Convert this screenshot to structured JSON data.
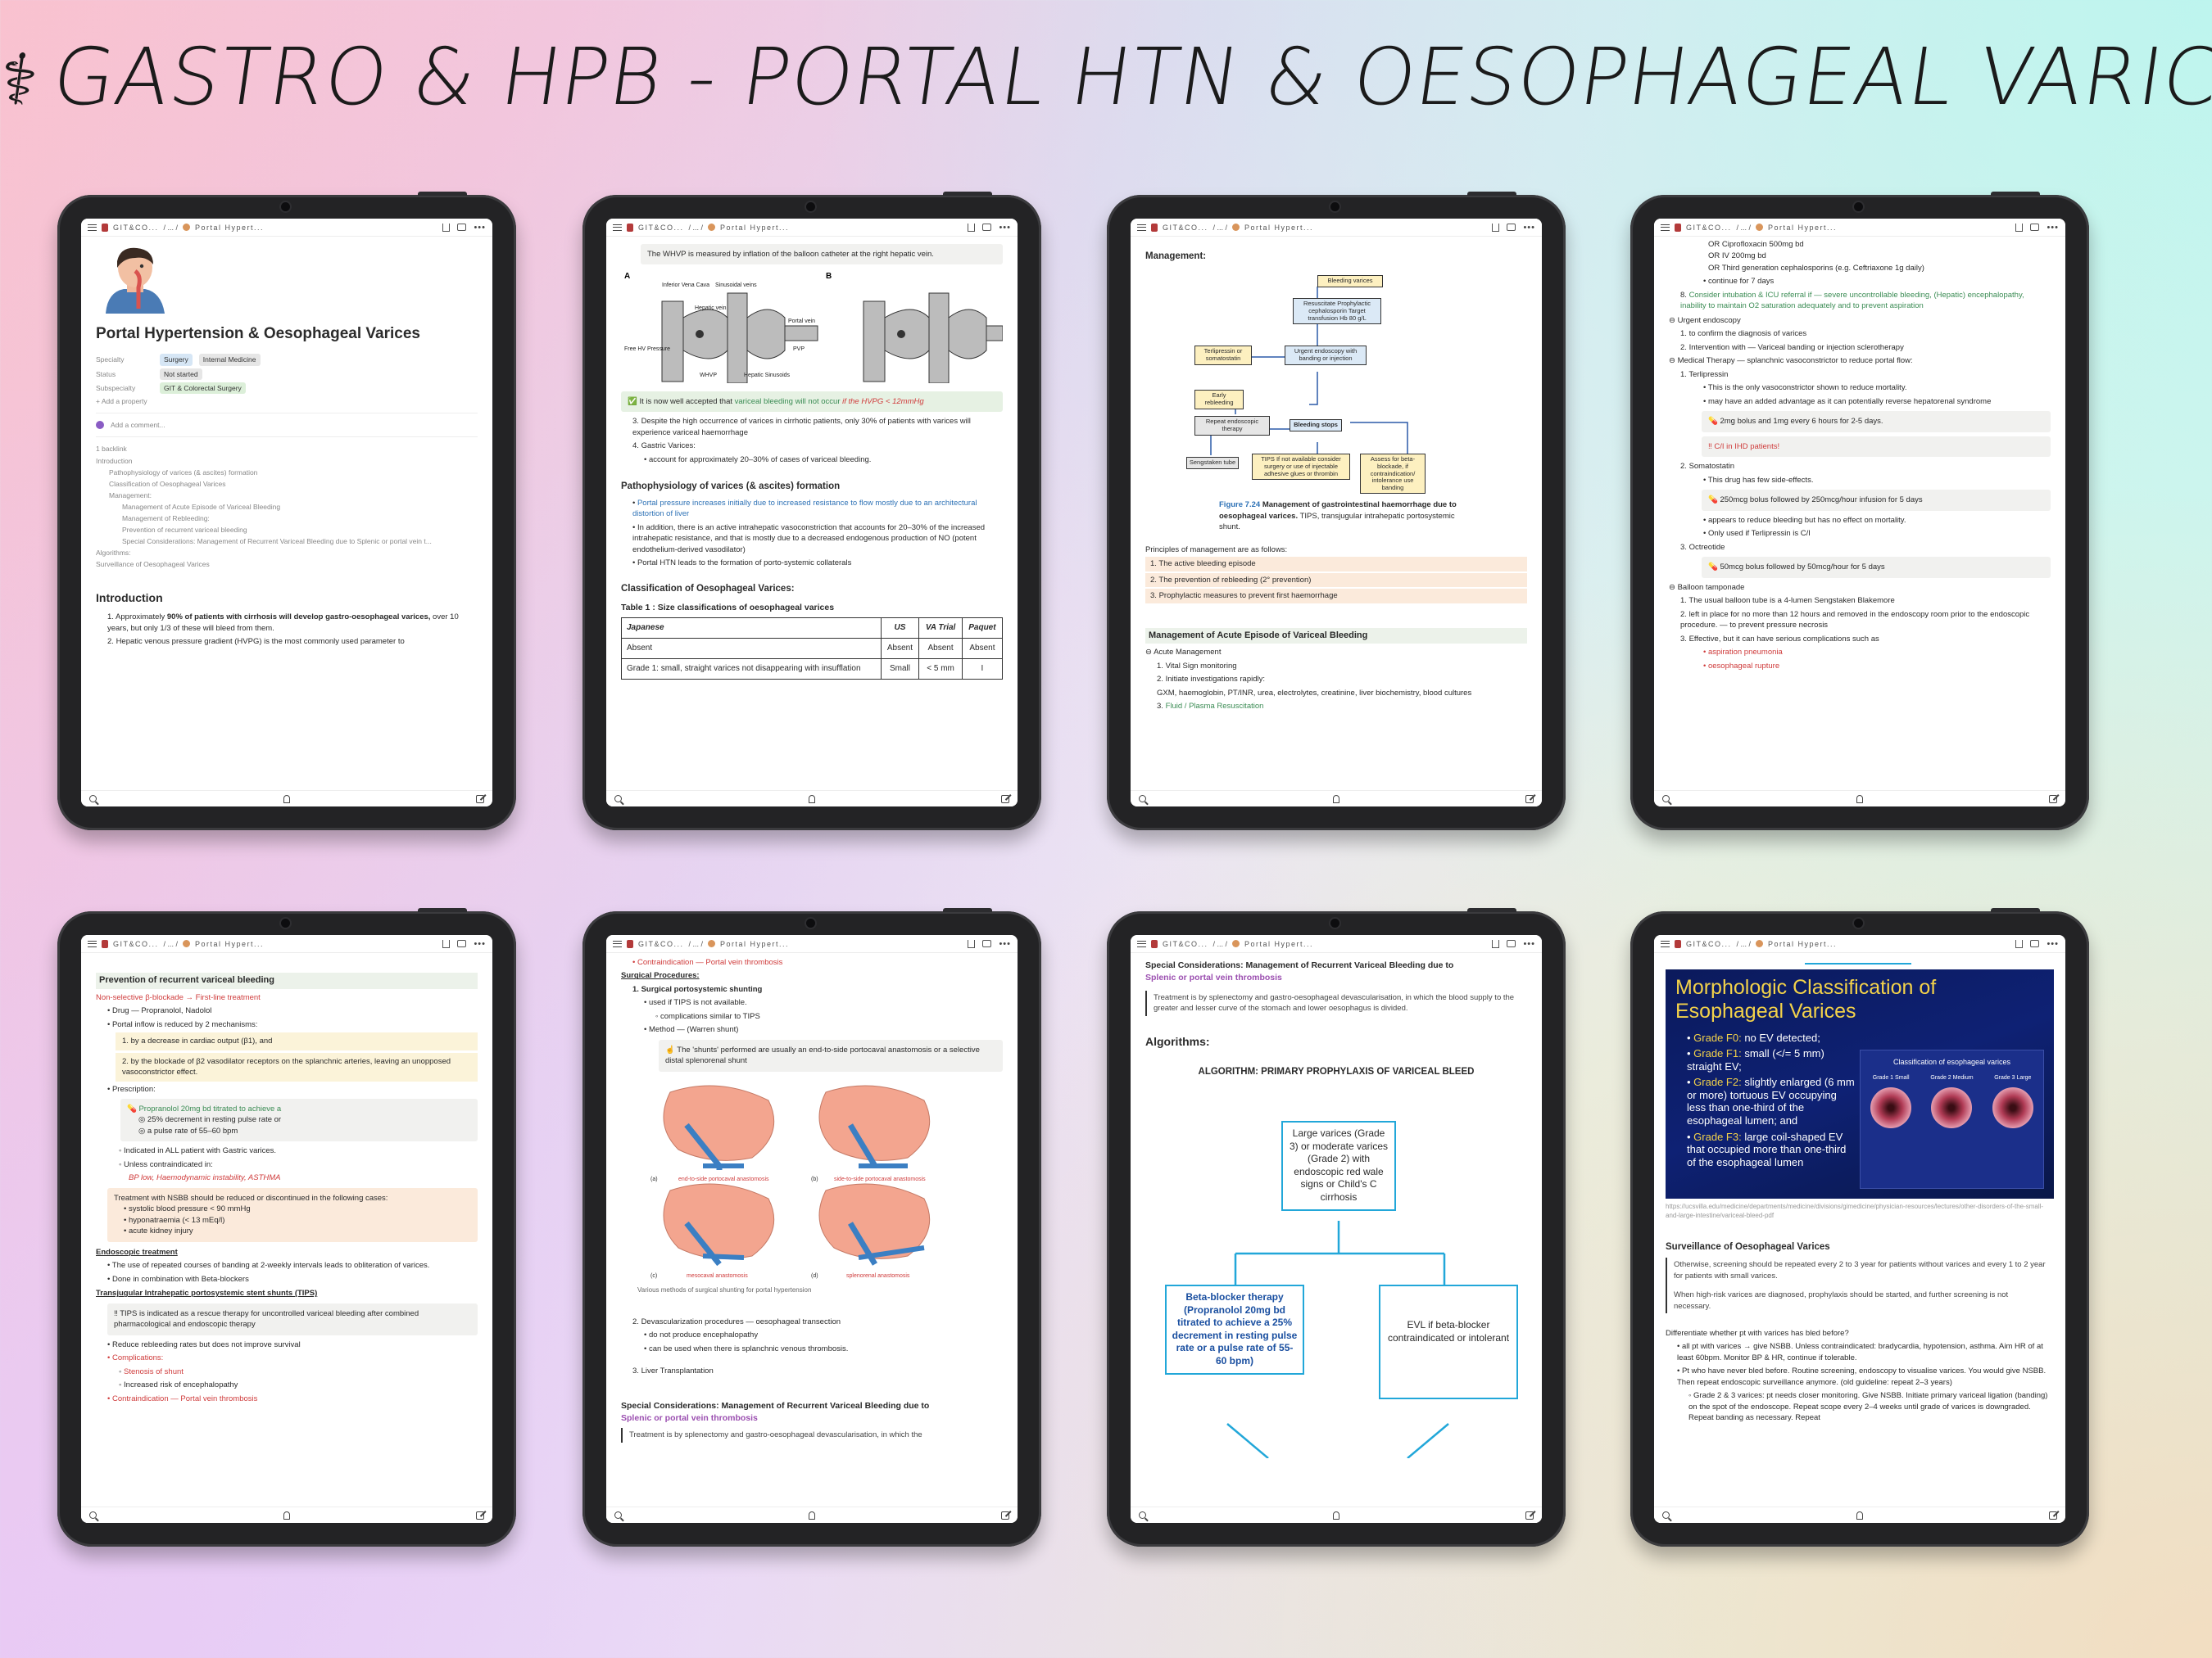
{
  "title": {
    "prefix": "⚕",
    "text": "GASTRO & HPB - PORTAL HTN & OESOPHAGEAL VARICES"
  },
  "topbar": {
    "workspace": "GIT&CO...",
    "sep": "/ ... /",
    "page": "Portal Hypert..."
  },
  "t1": {
    "heading": "Portal Hypertension & Oesophageal Varices",
    "props": [
      {
        "k": "Specialty",
        "v1": "Surgery",
        "v2": "Internal Medicine"
      },
      {
        "k": "Status",
        "v1": "Not started"
      },
      {
        "k": "Subspecialty",
        "v1": "GIT & Colorectal Surgery"
      }
    ],
    "add_property": "+ Add a property",
    "add_comment": "Add a comment...",
    "backlink": "1 backlink",
    "toc": [
      "Introduction",
      "Pathophysiology of varices (& ascites) formation",
      "Classification of Oesophageal Varices",
      "Management:",
      "Management of Acute Episode of Variceal Bleeding",
      "Management of Rebleeding:",
      "Prevention of recurrent variceal bleeding",
      "Special Considerations: Management of Recurrent Variceal Bleeding due to Splenic or portal vein t...",
      "Algorithms:",
      "Surveillance of Oesophageal Varices"
    ],
    "intro_h": "Introduction",
    "intro1a": "Approximately ",
    "intro1b": "90% of patients with cirrhosis will develop gastro-oesophageal varices,",
    "intro1c": " over 10 years, but only 1/3 of these will bleed from them.",
    "intro2": "Hepatic venous pressure gradient (HVPG) is the most commonly used parameter to"
  },
  "t2": {
    "wvhp": "The WHVP is measured by inflation of the balloon catheter at the right hepatic vein.",
    "fig_labels": [
      "A",
      "B",
      "Inferior Vena Cava",
      "Sinusoidal veins",
      "Hepatic vein",
      "Portal vein",
      "Free HV Pressure",
      "WHVP",
      "Hepatic Sinusoids",
      "PVP"
    ],
    "accepted_a": "It is now well accepted that ",
    "accepted_b": "variceal bleeding will not occur",
    "accepted_c": " if the HVPG < 12mmHg",
    "p3": "Despite the high occurrence of varices in cirrhotic patients, only 30% of patients with varices will experience variceal haemorrhage",
    "p4": "Gastric Varices:",
    "p4a": "account for approximately 20–30% of cases of variceal bleeding.",
    "patho_h": "Pathophysiology of varices (& ascites) formation",
    "b1": "Portal pressure increases initially due to increased resistance to flow mostly due to an architectural distortion of liver",
    "b2": "In addition, there is an active intrahepatic vasoconstriction that accounts for 20–30% of the increased intrahepatic resistance, and that is mostly due to a decreased endogenous production of NO (potent endothelium-derived vasodilator)",
    "b3": "Portal HTN leads to the formation of porto-systemic collaterals",
    "class_h": "Classification of Oesophageal Varices:",
    "table_title": "Table 1 : Size classifications of oesophageal varices",
    "table_head": [
      "Japanese",
      "US",
      "VA Trial",
      "Paquet"
    ],
    "table_rows": [
      [
        "Absent",
        "Absent",
        "Absent",
        "Absent"
      ],
      [
        "Grade 1: small, straight varices not disappearing with insufflation",
        "Small",
        "< 5 mm",
        "I"
      ]
    ]
  },
  "t3": {
    "mgmt_h": "Management:",
    "flow": [
      "Bleeding varices",
      "Resuscitate Prophylactic cephalosporin Target transfusion Hb 80 g/L",
      "Terlipressin or somatostatin",
      "Early rebleeding",
      "Urgent endoscopy with banding or injection",
      "Repeat endoscopic therapy",
      "Bleeding stops",
      "Sengstaken tube",
      "TIPS If not available consider surgery or use of injectable adhesive glues or thrombin",
      "Assess for beta-blockade, if contraindication/ intolerance use banding"
    ],
    "fig_cap_a": "Figure 7.24",
    "fig_cap_b": "Management of gastrointestinal haemorrhage due to oesophageal varices.",
    "fig_cap_c": " TIPS, transjugular intrahepatic portosystemic shunt.",
    "principles": "Principles of management are as follows:",
    "pr": [
      "The active bleeding episode",
      "The prevention of rebleeding (2° prevention)",
      "Prophylactic measures to prevent first haemorrhage"
    ],
    "acute_h": "Management of Acute Episode of Variceal Bleeding",
    "acute_sub": "⊖ Acute Management",
    "a1": "Vital Sign monitoring",
    "a2": "Initiate investigations rapidly:",
    "a2b": "GXM, haemoglobin, PT/INR, urea, electrolytes, creatinine, liver biochemistry, blood cultures",
    "a3": "Fluid / Plasma Resuscitation"
  },
  "t4": {
    "l1": "OR Ciprofloxacin 500mg bd",
    "l2": "OR IV 200mg bd",
    "l3": "OR Third generation cephalosporins (e.g. Ceftriaxone 1g daily)",
    "l4": "continue for 7 days",
    "l5": "Consider intubation & ICU referral if — severe uncontrollable bleeding, (Hepatic) encephalopathy, inability to maintain O2 saturation adequately and to prevent aspiration",
    "ue": "⊖ Urgent endoscopy",
    "ue1": "to confirm the diagnosis of varices",
    "ue2": "Intervention with — Variceal banding or injection sclerotherapy",
    "mt": "⊖ Medical Therapy — splanchnic vasoconstrictor to reduce portal flow:",
    "terli": "Terlipressin",
    "terli1": "This is the only vasoconstrictor shown to reduce mortality.",
    "terli2": "may have an added advantage as it can potentially reverse hepatorenal syndrome",
    "terli_dose": "2mg bolus and 1mg every 6 hours for 2-5 days.",
    "terli_ci": "‼ C/I in IHD patients!",
    "soma": "Somatostatin",
    "soma1": "This drug has few side-effects.",
    "soma_dose": "250mcg bolus followed by 250mcg/hour infusion for 5 days",
    "soma2": "appears to reduce bleeding but has no effect on mortality.",
    "soma3": "Only used if Terlipressin is C/I",
    "octr": "Octreotide",
    "octr_dose": "50mcg bolus followed by 50mcg/hour for 5 days",
    "bt": "⊖ Balloon tamponade",
    "bt1": "The usual balloon tube is a 4-lumen Sengstaken Blakemore",
    "bt2": "left in place for no more than 12 hours and removed in the endoscopy room prior to the endoscopic procedure. — to prevent pressure necrosis",
    "bt3": "Effective, but it can have serious complications such as",
    "bt3a": "aspiration pneumonia",
    "bt3b": "oesophageal rupture"
  },
  "t5": {
    "h": "Prevention of recurrent variceal bleeding",
    "nsbb": "Non-selective β-blockade → First-line treatment",
    "drug": "Drug — Propranolol, Nadolol",
    "inflow": "Portal inflow is reduced by 2 mechanisms:",
    "m1": "by a decrease in cardiac output (β1), and",
    "m2": "by the blockade of β2 vasodilator receptors on the splanchnic arteries, leaving an unopposed vasoconstrictor effect.",
    "rx": "Prescription:",
    "rx1": "Propranolol 20mg bd titrated to achieve a",
    "rx2": "◎ 25% decrement in resting pulse rate or",
    "rx3": "◎ a pulse rate of 55–60 bpm",
    "ind": "Indicated in ALL patient with Gastric varices.",
    "unless": "Unless contraindicated in:",
    "ci": "BP low, Haemodynamic instability, ASTHMA",
    "stop": "Treatment with NSBB should be reduced or discontinued in the following cases:",
    "s1": "systolic blood pressure < 90 mmHg",
    "s2": "hyponatraemia (< 13 mEq/l)",
    "s3": "acute kidney injury",
    "endo_h": "Endoscopic treatment",
    "e1": "The use of repeated courses of banding at 2-weekly intervals leads to obliteration of varices.",
    "e2": "Done in combination with Beta-blockers",
    "tips_h": "Transjugular Intrahepatic portosystemic stent shunts (TIPS)",
    "tips_c": "‼ TIPS is indicated as a rescue therapy for uncontrolled variceal bleeding after combined pharmacological and endoscopic therapy",
    "t1": "Reduce rebleeding rates but does not improve survival",
    "t2": "Complications:",
    "t2a": "Stenosis of shunt",
    "t2b": "Increased risk of encephalopathy",
    "t3": "Contraindication — Portal vein thrombosis"
  },
  "t6": {
    "top": "Contraindication — Portal vein thrombosis",
    "sp": "Surgical Procedures:",
    "s1": "Surgical portosystemic shunting",
    "s1a": "used if TIPS is not available.",
    "s1b": "complications similar to TIPS",
    "s1c": "Method — (Warren shunt)",
    "callout": "The 'shunts' performed are usually an end-to-side portocaval anastomosis or a selective distal splenorenal shunt",
    "fig_a": "end-to-side portocaval anastomosis",
    "fig_b": "side-to-side portocaval anastomosis",
    "fig_c": "mesocaval anastomosis",
    "fig_d": "splenorenal anastomosis",
    "fig_cap": "Various methods of surgical shunting for portal hypertension",
    "s2": "Devascularization procedures — oesophageal transection",
    "s2a": "do not produce encephalopathy",
    "s2b": "can be used when there is splanchnic venous thrombosis.",
    "s3": "Liver Transplantation",
    "sc_h1": "Special Considerations: Management of Recurrent Variceal Bleeding due to",
    "sc_h2": "Splenic or portal vein thrombosis",
    "sc_p": "Treatment is by splenectomy and gastro-oesophageal devascularisation, in which the"
  },
  "t7": {
    "h1": "Special Considerations: Management of Recurrent Variceal Bleeding due to",
    "h2": "Splenic or portal vein thrombosis",
    "quote": "Treatment is by splenectomy and gastro-oesophageal devascularisation, in which the blood supply to the greater and lesser curve of the stomach and lower oesophagus is divided.",
    "algo_h": "Algorithms:",
    "algo_title": "ALGORITHM: PRIMARY PROPHYLAXIS OF VARICEAL BLEED",
    "box1": "Large varices (Grade 3) or moderate varices (Grade 2) with endoscopic red wale signs or Child's C cirrhosis",
    "box2": "Beta-blocker therapy (Propranolol 20mg bd titrated to achieve a 25% decrement in resting pulse rate or a pulse rate of 55-60 bpm)",
    "box3": "EVL if beta-blocker contraindicated or intolerant"
  },
  "t8": {
    "slide_title": "Morphologic Classification of Esophageal Varices",
    "grades": [
      {
        "g": "Grade F0:",
        "t": " no EV detected;"
      },
      {
        "g": "Grade F1:",
        "t": " small (</= 5 mm) straight EV;"
      },
      {
        "g": "Grade F2:",
        "t": " slightly enlarged (6 mm or more) tortuous EV occupying less than one-third of the esophageal lumen; and"
      },
      {
        "g": "Grade F3:",
        "t": " large coil-shaped EV that occupied more than one-third of the esophageal lumen"
      }
    ],
    "fig_title": "Classification of esophageal varices",
    "fig_cols": [
      "Grade 1 Small",
      "Grade 2 Medium",
      "Grade 3 Large"
    ],
    "link": "https://ucsvilla.edu/medicine/departments/medicine/divisions/gimedicine/physician-resources/lectures/other-disorders-of-the-small-and-large-intestine/variceal-bleed-pdf",
    "surv_h": "Surveillance of Oesophageal Varices",
    "q1": "Otherwise, screening should be repeated every 2 to 3 year for patients without varices and every 1 to 2 year for patients with small varices.",
    "q2": "When high-risk varices are diagnosed, prophylaxis should be started, and further screening is not necessary.",
    "diff": "Differentiate whether pt with varices has bled before?",
    "d1": "all pt with varices → give NSBB. Unless contraindicated: bradycardia, hypotension, asthma. Aim HR of at least 60bpm. Monitor BP & HR, continue if tolerable.",
    "d2": "Pt who have never bled before. Routine screening, endoscopy to visualise varices. You would give NSBB. Then repeat endoscopic surveillance anymore. (old guideline: repeat 2–3 years)",
    "d3": "Grade 2 & 3 varices: pt needs closer monitoring. Give NSBB. Initiate primary variceal ligation (banding) on the spot of the endoscope. Repeat scope every 2–4 weeks until grade of varices is downgraded. Repeat banding as necessary. Repeat"
  }
}
